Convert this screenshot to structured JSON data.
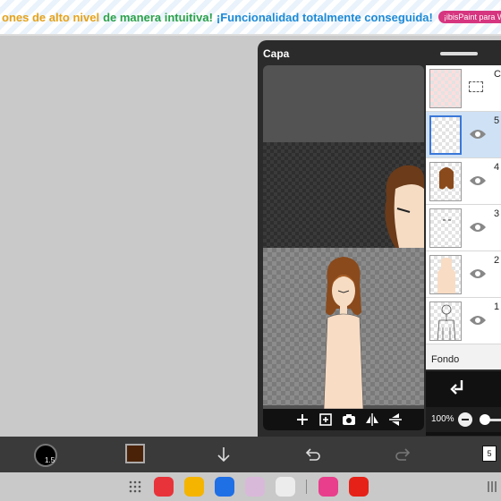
{
  "banner": {
    "text_part1": "ones de alto nivel",
    "text_part2": "de manera intuitiva!",
    "text_part3": "¡Funcionalidad totalmente conseguida!",
    "badge": "¡ibisPaint para Wi"
  },
  "layer_panel": {
    "title": "Capa",
    "layers": [
      {
        "num": "C",
        "type": "selection"
      },
      {
        "num": "5",
        "selected": true
      },
      {
        "num": "4"
      },
      {
        "num": "3"
      },
      {
        "num": "2"
      },
      {
        "num": "1"
      }
    ],
    "background_label": "Fondo",
    "opacity": "100%"
  },
  "toolbar": {
    "brush_size": "1.5",
    "current_color": "#4a2208",
    "layer_count": "5"
  },
  "colors": {
    "accent": "#3a78d8",
    "panel": "#2b2b2b"
  }
}
